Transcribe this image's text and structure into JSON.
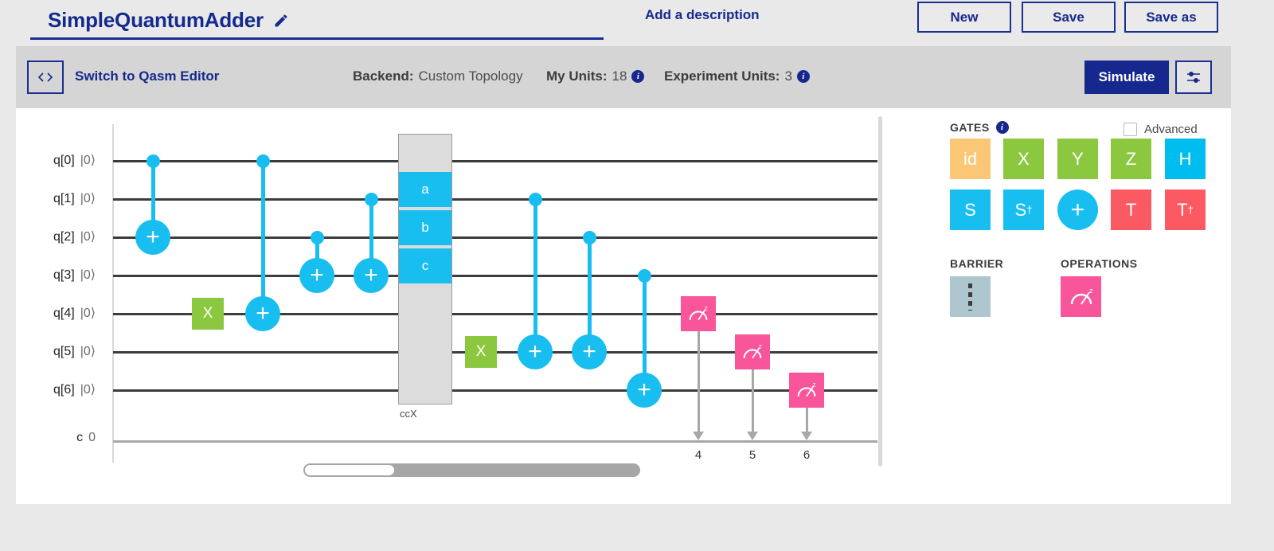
{
  "titlebar": {
    "project_title": "SimpleQuantumAdder",
    "edit_icon": "pencil-icon",
    "add_description": "Add a description",
    "buttons": [
      {
        "label": "New"
      },
      {
        "label": "Save"
      },
      {
        "label": "Save as"
      }
    ]
  },
  "toolbar": {
    "qasm_icon": "code-brackets-icon",
    "qasm_label": "Switch to Qasm Editor",
    "backend_label": "Backend:",
    "backend_value": "Custom Topology",
    "my_units_label": "My Units:",
    "my_units_value": "18",
    "experiment_units_label": "Experiment Units:",
    "experiment_units_value": "3",
    "info_glyph": "i",
    "simulate_label": "Simulate",
    "settings_icon": "sliders-icon"
  },
  "circuit": {
    "qubits": [
      {
        "name": "q[0]",
        "state": "|0⟩"
      },
      {
        "name": "q[1]",
        "state": "|0⟩"
      },
      {
        "name": "q[2]",
        "state": "|0⟩"
      },
      {
        "name": "q[3]",
        "state": "|0⟩"
      },
      {
        "name": "q[4]",
        "state": "|0⟩"
      },
      {
        "name": "q[5]",
        "state": "|0⟩"
      },
      {
        "name": "q[6]",
        "state": "|0⟩"
      }
    ],
    "classical": {
      "name": "c",
      "width": "0"
    },
    "ccx": {
      "label": "ccX",
      "segments": [
        {
          "label": "a"
        },
        {
          "label": "b"
        },
        {
          "label": "c"
        }
      ]
    },
    "x_gates": [
      {
        "label": "X",
        "qubit": 4
      },
      {
        "label": "X",
        "qubit": 5
      }
    ],
    "cnots": [
      {
        "control": 0,
        "target": 2
      },
      {
        "control": 0,
        "target": 4
      },
      {
        "control": 2,
        "target": 3
      },
      {
        "control": 1,
        "target": 3
      },
      {
        "control": 1,
        "target": 5
      },
      {
        "control": 2,
        "target": 5
      },
      {
        "control": 3,
        "target": 6
      }
    ],
    "measurements": [
      {
        "qubit": 4,
        "cbit": "4",
        "icon": "measure-z-icon"
      },
      {
        "qubit": 5,
        "cbit": "5",
        "icon": "measure-z-icon"
      },
      {
        "qubit": 6,
        "cbit": "6",
        "icon": "measure-z-icon"
      }
    ]
  },
  "palette": {
    "gates_heading": "GATES",
    "gates_info_glyph": "i",
    "advanced_label": "Advanced",
    "advanced_checked": false,
    "gates": [
      {
        "label": "id",
        "sup": "",
        "color": "#fbc776",
        "shape": "square"
      },
      {
        "label": "X",
        "sup": "",
        "color": "#8cc740",
        "shape": "square"
      },
      {
        "label": "Y",
        "sup": "",
        "color": "#8cc740",
        "shape": "square"
      },
      {
        "label": "Z",
        "sup": "",
        "color": "#8cc740",
        "shape": "square"
      },
      {
        "label": "H",
        "sup": "",
        "color": "#00bdf0",
        "shape": "square"
      },
      {
        "label": "S",
        "sup": "",
        "color": "#19bef0",
        "shape": "square"
      },
      {
        "label": "S",
        "sup": "†",
        "color": "#19bef0",
        "shape": "square"
      },
      {
        "label": "+",
        "sup": "",
        "color": "#19bef0",
        "shape": "round"
      },
      {
        "label": "T",
        "sup": "",
        "color": "#fc5a63",
        "shape": "square"
      },
      {
        "label": "T",
        "sup": "†",
        "color": "#fc5a63",
        "shape": "square"
      }
    ],
    "barrier_heading": "BARRIER",
    "barrier_icon": "barrier-icon",
    "operations_heading": "OPERATIONS",
    "operation_icon": "measure-z-icon"
  },
  "colors": {
    "brand_blue": "#16288d",
    "gate_blue": "#19bef0",
    "gate_green": "#8cc740",
    "gate_red": "#fc5a63",
    "gate_orange": "#fbc776",
    "measure_pink": "#f9559a",
    "page_bg": "#e9e9e9",
    "toolbar_bg": "#d5d5d5"
  }
}
